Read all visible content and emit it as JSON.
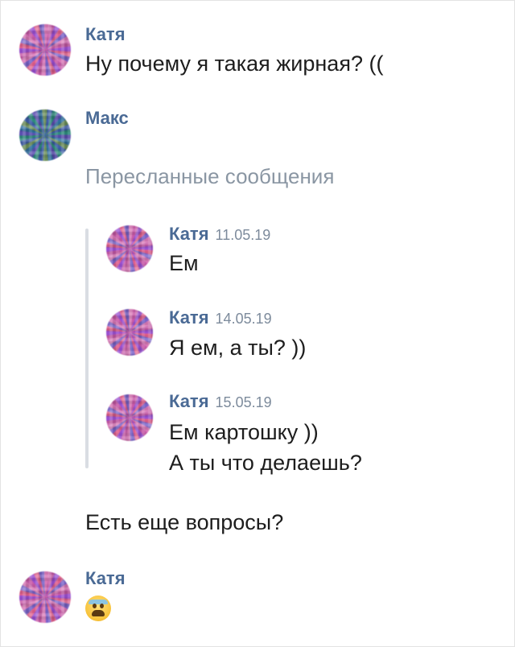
{
  "messages": [
    {
      "author": "Катя",
      "text": "Ну почему я такая жирная? (("
    },
    {
      "author": "Макс",
      "forwarded_label": "Пересланные сообщения",
      "text": "Есть еще вопросы?"
    },
    {
      "author": "Катя",
      "emoji": "anxious-face"
    }
  ],
  "forwarded": [
    {
      "author": "Катя",
      "date": "11.05.19",
      "lines": [
        "Ем"
      ]
    },
    {
      "author": "Катя",
      "date": "14.05.19",
      "lines": [
        "Я ем, а ты? ))"
      ]
    },
    {
      "author": "Катя",
      "date": "15.05.19",
      "lines": [
        "Ем картошку ))",
        "А ты что делаешь?"
      ]
    }
  ],
  "colors": {
    "name": "#4a6a95",
    "date": "#7d8b9c",
    "muted": "#8a96a3",
    "text": "#1d1d1d"
  }
}
